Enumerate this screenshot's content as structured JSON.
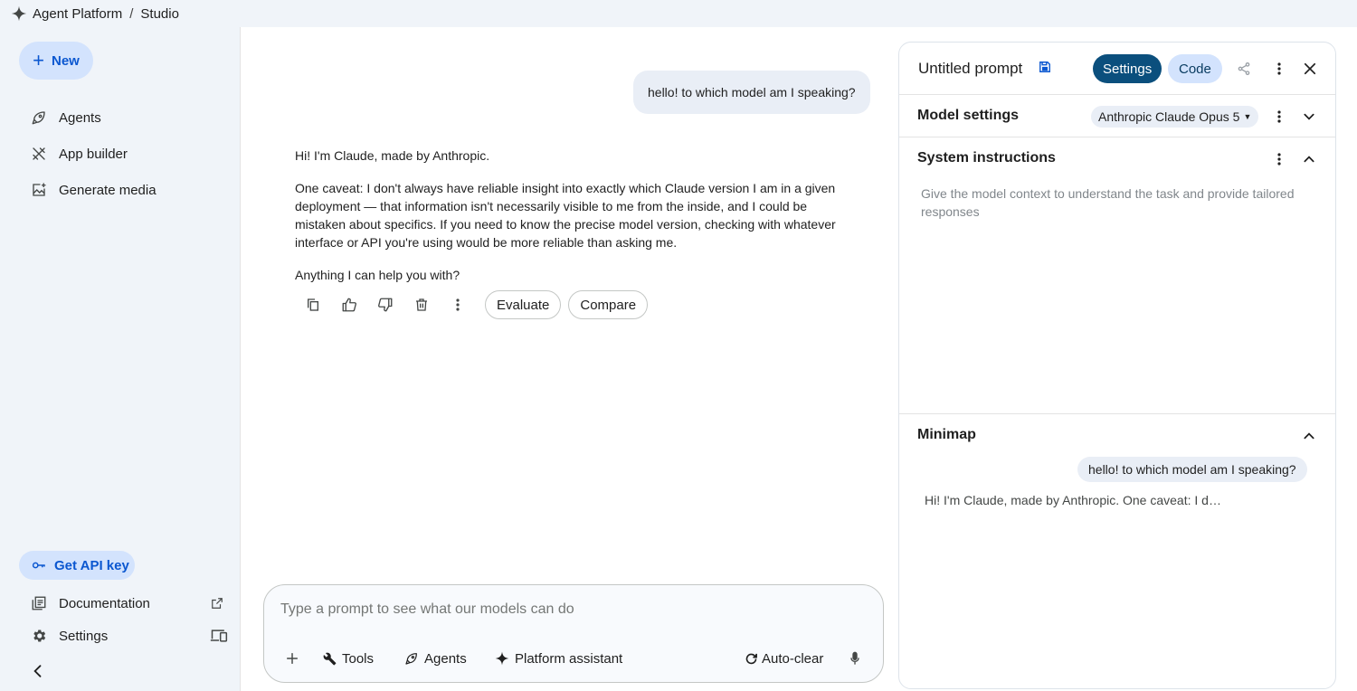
{
  "breadcrumb": {
    "root": "Agent Platform",
    "separator": "/",
    "current": "Studio"
  },
  "sidebar": {
    "new_label": "New",
    "items": [
      {
        "label": "Agents",
        "icon": "rocket-icon"
      },
      {
        "label": "App builder",
        "icon": "tools-icon"
      },
      {
        "label": "Generate media",
        "icon": "image-add-icon"
      }
    ],
    "api_key_label": "Get API key",
    "documentation_label": "Documentation",
    "settings_label": "Settings"
  },
  "chat": {
    "user_message": "hello! to which model am I speaking?",
    "reply_paragraphs": [
      "Hi! I'm Claude, made by Anthropic.",
      "One caveat: I don't always have reliable insight into exactly which Claude version I am in a given deployment — that information isn't necessarily visible to me from the inside, and I could be mistaken about specifics. If you need to know the precise model version, checking with whatever interface or API you're using would be more reliable than asking me.",
      "Anything I can help you with?"
    ],
    "evaluate_label": "Evaluate",
    "compare_label": "Compare"
  },
  "prompt": {
    "placeholder": "Type a prompt to see what our models can do",
    "value": "",
    "tools_label": "Tools",
    "agents_label": "Agents",
    "assistant_label": "Platform assistant",
    "autoclear_label": "Auto-clear"
  },
  "right_panel": {
    "title": "Untitled prompt",
    "settings_tab": "Settings",
    "code_tab": "Code",
    "model_settings_title": "Model settings",
    "model_name": "Anthropic Claude Opus 5",
    "system_instructions_title": "System instructions",
    "system_instructions_placeholder": "Give the model context to understand the task and provide tailored responses",
    "minimap_title": "Minimap",
    "minimap_user": "hello! to which model am I speaking?",
    "minimap_reply": "Hi! I'm Claude, made by Anthropic. One caveat: I d…"
  },
  "colors": {
    "accent": "#0b57d0",
    "accent_light": "#d3e3fd",
    "tab_active": "#0b4f7d",
    "background": "#f0f4f9"
  }
}
